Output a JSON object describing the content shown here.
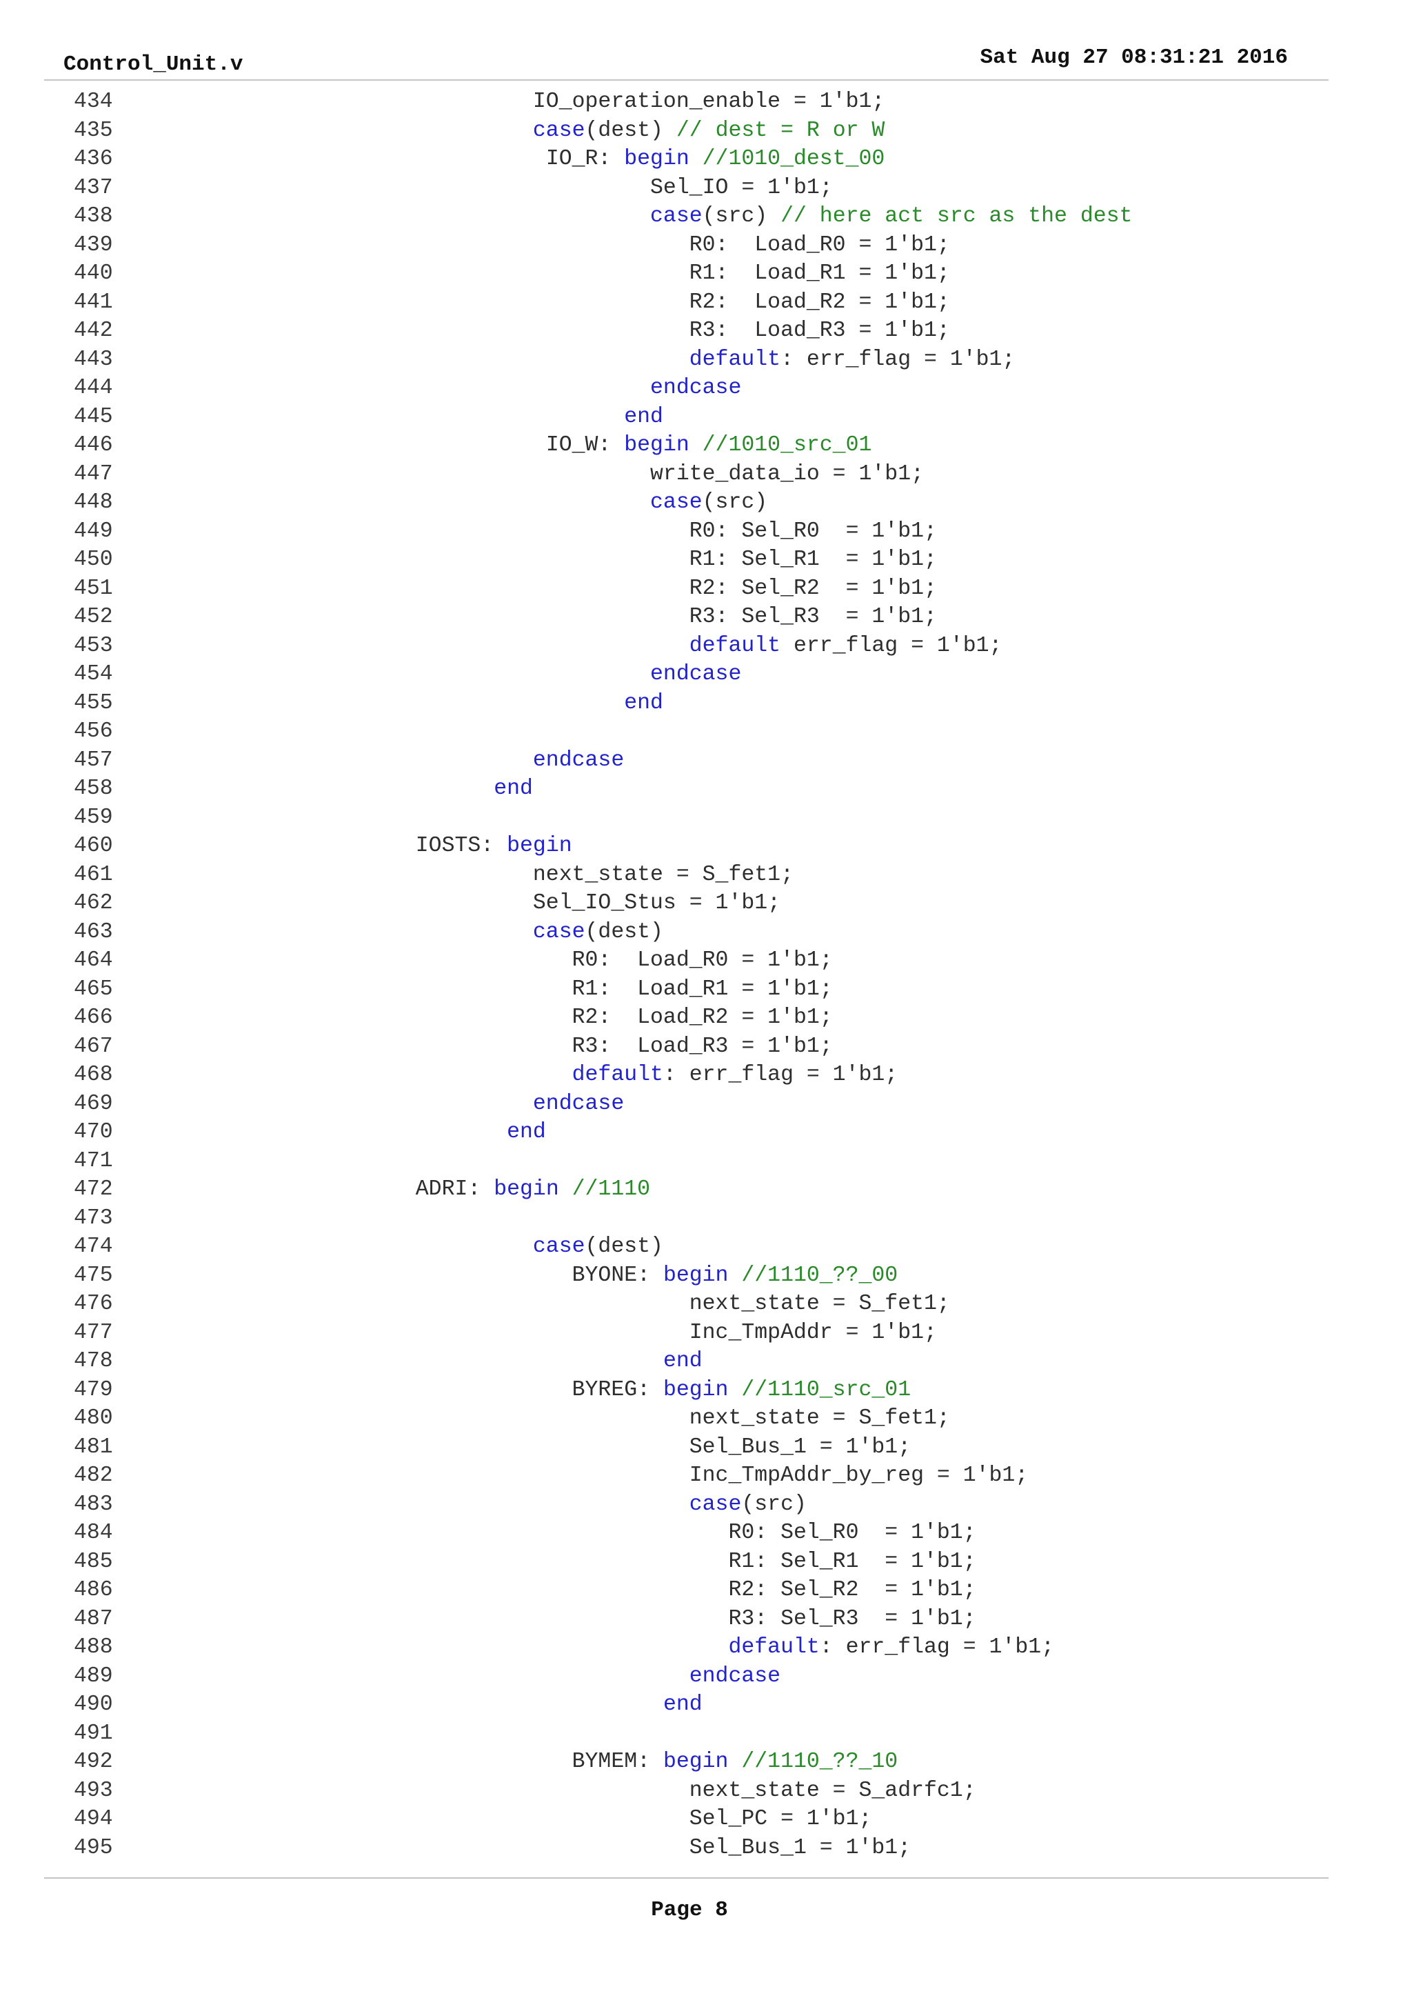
{
  "header": {
    "filename": "Control_Unit.v",
    "timestamp": "Sat Aug 27 08:31:21 2016"
  },
  "footer": {
    "page_label": "Page 8"
  },
  "code_lines": [
    {
      "n": "434",
      "indent": 32,
      "tokens": [
        [
          "t",
          "IO_operation_enable = 1'b1;"
        ]
      ]
    },
    {
      "n": "435",
      "indent": 32,
      "tokens": [
        [
          "k",
          "case"
        ],
        [
          "t",
          "(dest) "
        ],
        [
          "c",
          "// dest = R or W"
        ]
      ]
    },
    {
      "n": "436",
      "indent": 33,
      "tokens": [
        [
          "t",
          "IO_R: "
        ],
        [
          "k",
          "begin"
        ],
        [
          "t",
          " "
        ],
        [
          "c",
          "//1010_dest_00"
        ]
      ]
    },
    {
      "n": "437",
      "indent": 41,
      "tokens": [
        [
          "t",
          "Sel_IO = 1'b1;"
        ]
      ]
    },
    {
      "n": "438",
      "indent": 41,
      "tokens": [
        [
          "k",
          "case"
        ],
        [
          "t",
          "(src) "
        ],
        [
          "c",
          "// here act src as the dest"
        ]
      ]
    },
    {
      "n": "439",
      "indent": 44,
      "tokens": [
        [
          "t",
          "R0:  Load_R0 = 1'b1;"
        ]
      ]
    },
    {
      "n": "440",
      "indent": 44,
      "tokens": [
        [
          "t",
          "R1:  Load_R1 = 1'b1;"
        ]
      ]
    },
    {
      "n": "441",
      "indent": 44,
      "tokens": [
        [
          "t",
          "R2:  Load_R2 = 1'b1;"
        ]
      ]
    },
    {
      "n": "442",
      "indent": 44,
      "tokens": [
        [
          "t",
          "R3:  Load_R3 = 1'b1;"
        ]
      ]
    },
    {
      "n": "443",
      "indent": 44,
      "tokens": [
        [
          "k",
          "default"
        ],
        [
          "t",
          ": err_flag = 1'b1;"
        ]
      ]
    },
    {
      "n": "444",
      "indent": 41,
      "tokens": [
        [
          "k",
          "endcase"
        ]
      ]
    },
    {
      "n": "445",
      "indent": 39,
      "tokens": [
        [
          "k",
          "end"
        ]
      ]
    },
    {
      "n": "446",
      "indent": 33,
      "tokens": [
        [
          "t",
          "IO_W: "
        ],
        [
          "k",
          "begin"
        ],
        [
          "t",
          " "
        ],
        [
          "c",
          "//1010_src_01"
        ]
      ]
    },
    {
      "n": "447",
      "indent": 41,
      "tokens": [
        [
          "t",
          "write_data_io = 1'b1;"
        ]
      ]
    },
    {
      "n": "448",
      "indent": 41,
      "tokens": [
        [
          "k",
          "case"
        ],
        [
          "t",
          "(src)"
        ]
      ]
    },
    {
      "n": "449",
      "indent": 44,
      "tokens": [
        [
          "t",
          "R0: Sel_R0  = 1'b1;"
        ]
      ]
    },
    {
      "n": "450",
      "indent": 44,
      "tokens": [
        [
          "t",
          "R1: Sel_R1  = 1'b1;"
        ]
      ]
    },
    {
      "n": "451",
      "indent": 44,
      "tokens": [
        [
          "t",
          "R2: Sel_R2  = 1'b1;"
        ]
      ]
    },
    {
      "n": "452",
      "indent": 44,
      "tokens": [
        [
          "t",
          "R3: Sel_R3  = 1'b1;"
        ]
      ]
    },
    {
      "n": "453",
      "indent": 44,
      "tokens": [
        [
          "k",
          "default"
        ],
        [
          "t",
          " err_flag = 1'b1;"
        ]
      ]
    },
    {
      "n": "454",
      "indent": 41,
      "tokens": [
        [
          "k",
          "endcase"
        ]
      ]
    },
    {
      "n": "455",
      "indent": 39,
      "tokens": [
        [
          "k",
          "end"
        ]
      ]
    },
    {
      "n": "456",
      "indent": 0,
      "tokens": []
    },
    {
      "n": "457",
      "indent": 32,
      "tokens": [
        [
          "k",
          "endcase"
        ]
      ]
    },
    {
      "n": "458",
      "indent": 29,
      "tokens": [
        [
          "k",
          "end"
        ]
      ]
    },
    {
      "n": "459",
      "indent": 0,
      "tokens": []
    },
    {
      "n": "460",
      "indent": 23,
      "tokens": [
        [
          "t",
          "IOSTS: "
        ],
        [
          "k",
          "begin"
        ]
      ]
    },
    {
      "n": "461",
      "indent": 32,
      "tokens": [
        [
          "t",
          "next_state = S_fet1;"
        ]
      ]
    },
    {
      "n": "462",
      "indent": 32,
      "tokens": [
        [
          "t",
          "Sel_IO_Stus = 1'b1;"
        ]
      ]
    },
    {
      "n": "463",
      "indent": 32,
      "tokens": [
        [
          "k",
          "case"
        ],
        [
          "t",
          "(dest)"
        ]
      ]
    },
    {
      "n": "464",
      "indent": 35,
      "tokens": [
        [
          "t",
          "R0:  Load_R0 = 1'b1;"
        ]
      ]
    },
    {
      "n": "465",
      "indent": 35,
      "tokens": [
        [
          "t",
          "R1:  Load_R1 = 1'b1;"
        ]
      ]
    },
    {
      "n": "466",
      "indent": 35,
      "tokens": [
        [
          "t",
          "R2:  Load_R2 = 1'b1;"
        ]
      ]
    },
    {
      "n": "467",
      "indent": 35,
      "tokens": [
        [
          "t",
          "R3:  Load_R3 = 1'b1;"
        ]
      ]
    },
    {
      "n": "468",
      "indent": 35,
      "tokens": [
        [
          "k",
          "default"
        ],
        [
          "t",
          ": err_flag = 1'b1;"
        ]
      ]
    },
    {
      "n": "469",
      "indent": 32,
      "tokens": [
        [
          "k",
          "endcase"
        ]
      ]
    },
    {
      "n": "470",
      "indent": 30,
      "tokens": [
        [
          "k",
          "end"
        ]
      ]
    },
    {
      "n": "471",
      "indent": 0,
      "tokens": []
    },
    {
      "n": "472",
      "indent": 23,
      "tokens": [
        [
          "t",
          "ADRI: "
        ],
        [
          "k",
          "begin"
        ],
        [
          "t",
          " "
        ],
        [
          "c",
          "//1110"
        ]
      ]
    },
    {
      "n": "473",
      "indent": 0,
      "tokens": []
    },
    {
      "n": "474",
      "indent": 32,
      "tokens": [
        [
          "k",
          "case"
        ],
        [
          "t",
          "(dest)"
        ]
      ]
    },
    {
      "n": "475",
      "indent": 35,
      "tokens": [
        [
          "t",
          "BYONE: "
        ],
        [
          "k",
          "begin"
        ],
        [
          "t",
          " "
        ],
        [
          "c",
          "//1110_??_00"
        ]
      ]
    },
    {
      "n": "476",
      "indent": 44,
      "tokens": [
        [
          "t",
          "next_state = S_fet1;"
        ]
      ]
    },
    {
      "n": "477",
      "indent": 44,
      "tokens": [
        [
          "t",
          "Inc_TmpAddr = 1'b1;"
        ]
      ]
    },
    {
      "n": "478",
      "indent": 42,
      "tokens": [
        [
          "k",
          "end"
        ]
      ]
    },
    {
      "n": "479",
      "indent": 35,
      "tokens": [
        [
          "t",
          "BYREG: "
        ],
        [
          "k",
          "begin"
        ],
        [
          "t",
          " "
        ],
        [
          "c",
          "//1110_src_01"
        ]
      ]
    },
    {
      "n": "480",
      "indent": 44,
      "tokens": [
        [
          "t",
          "next_state = S_fet1;"
        ]
      ]
    },
    {
      "n": "481",
      "indent": 44,
      "tokens": [
        [
          "t",
          "Sel_Bus_1 = 1'b1;"
        ]
      ]
    },
    {
      "n": "482",
      "indent": 44,
      "tokens": [
        [
          "t",
          "Inc_TmpAddr_by_reg = 1'b1;"
        ]
      ]
    },
    {
      "n": "483",
      "indent": 44,
      "tokens": [
        [
          "k",
          "case"
        ],
        [
          "t",
          "(src)"
        ]
      ]
    },
    {
      "n": "484",
      "indent": 47,
      "tokens": [
        [
          "t",
          "R0: Sel_R0  = 1'b1;"
        ]
      ]
    },
    {
      "n": "485",
      "indent": 47,
      "tokens": [
        [
          "t",
          "R1: Sel_R1  = 1'b1;"
        ]
      ]
    },
    {
      "n": "486",
      "indent": 47,
      "tokens": [
        [
          "t",
          "R2: Sel_R2  = 1'b1;"
        ]
      ]
    },
    {
      "n": "487",
      "indent": 47,
      "tokens": [
        [
          "t",
          "R3: Sel_R3  = 1'b1;"
        ]
      ]
    },
    {
      "n": "488",
      "indent": 47,
      "tokens": [
        [
          "k",
          "default"
        ],
        [
          "t",
          ": err_flag = 1'b1;"
        ]
      ]
    },
    {
      "n": "489",
      "indent": 44,
      "tokens": [
        [
          "k",
          "endcase"
        ]
      ]
    },
    {
      "n": "490",
      "indent": 42,
      "tokens": [
        [
          "k",
          "end"
        ]
      ]
    },
    {
      "n": "491",
      "indent": 0,
      "tokens": []
    },
    {
      "n": "492",
      "indent": 35,
      "tokens": [
        [
          "t",
          "BYMEM: "
        ],
        [
          "k",
          "begin"
        ],
        [
          "t",
          " "
        ],
        [
          "c",
          "//1110_??_10"
        ]
      ]
    },
    {
      "n": "493",
      "indent": 44,
      "tokens": [
        [
          "t",
          "next_state = S_adrfc1;"
        ]
      ]
    },
    {
      "n": "494",
      "indent": 44,
      "tokens": [
        [
          "t",
          "Sel_PC = 1'b1;"
        ]
      ]
    },
    {
      "n": "495",
      "indent": 44,
      "tokens": [
        [
          "t",
          "Sel_Bus_1 = 1'b1;"
        ]
      ]
    }
  ]
}
